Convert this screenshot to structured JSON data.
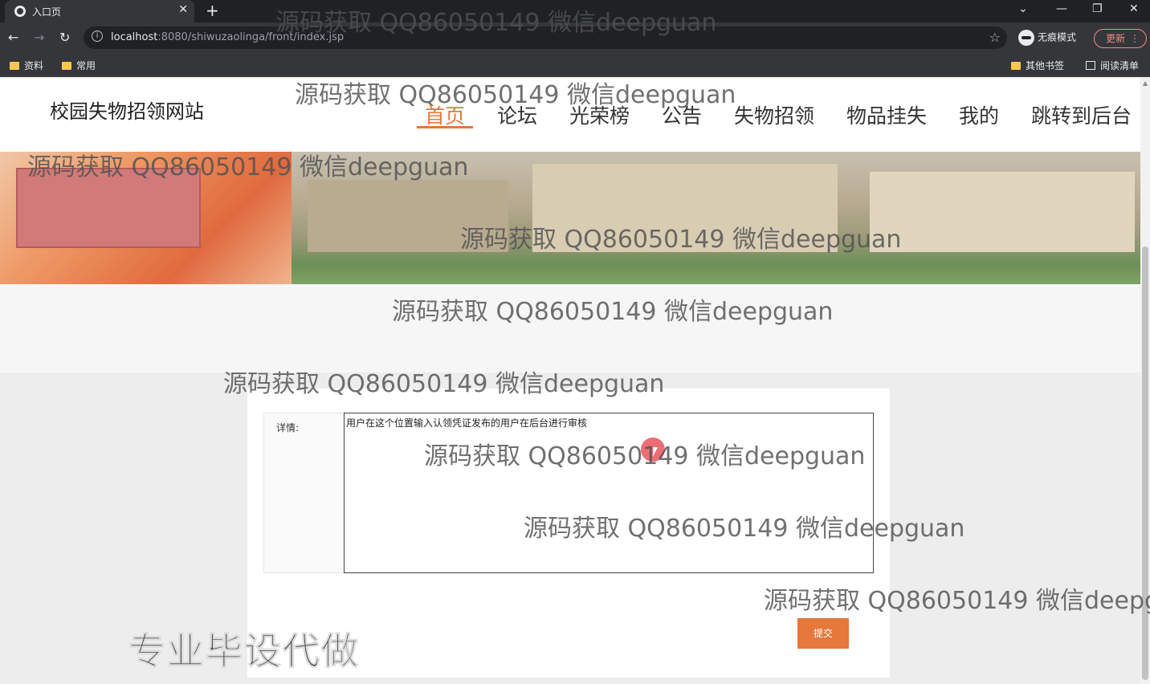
{
  "browser": {
    "tab_title": "入口页",
    "url_host": "localhost",
    "url_path": ":8080/shiwuzaolinga/front/index.jsp",
    "incognito_label": "无痕模式",
    "update_label": "更新",
    "bookmarks": [
      "资料",
      "常用"
    ],
    "other_bookmarks": "其他书签",
    "reading_list": "阅读清单"
  },
  "site": {
    "title": "校园失物招领网站",
    "nav": [
      {
        "label": "首页",
        "active": true
      },
      {
        "label": "论坛"
      },
      {
        "label": "光荣榜"
      },
      {
        "label": "公告"
      },
      {
        "label": "失物招领"
      },
      {
        "label": "物品挂失"
      },
      {
        "label": "我的"
      },
      {
        "label": "跳转到后台"
      }
    ]
  },
  "form": {
    "detail_label": "详情:",
    "detail_value": "用户在这个位置输入认领凭证发布的用户在后台进行审核",
    "submit_label": "提交"
  },
  "overlay": {
    "watermark": "源码获取 QQ86050149 微信deepguan",
    "watermark_cut": "源码获取 QQ86050149 微信deepg",
    "promo": "专业毕设代做"
  },
  "colors": {
    "accent": "#e5783a"
  }
}
